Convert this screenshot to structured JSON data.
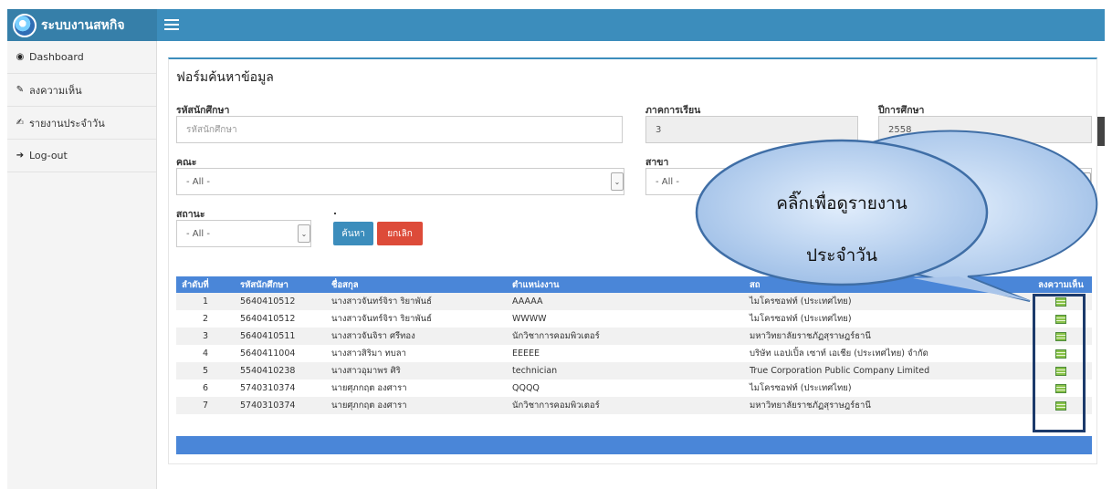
{
  "app": {
    "title": "ระบบงานสหกิจ"
  },
  "sidebar": {
    "items": [
      {
        "icon": "dashboard-icon",
        "label": "Dashboard"
      },
      {
        "icon": "pencil-icon",
        "label": "ลงความเห็น"
      },
      {
        "icon": "edit-icon",
        "label": "รายงานประจำวัน"
      },
      {
        "icon": "logout-icon",
        "label": "Log-out"
      }
    ]
  },
  "form": {
    "title": "ฟอร์มค้นหาข้อมูล",
    "student_id": {
      "label": "รหัสนักศึกษา",
      "placeholder": "รหัสนักศึกษา"
    },
    "semester": {
      "label": "ภาคการเรียน",
      "value": "3"
    },
    "year": {
      "label": "ปีการศึกษา",
      "value": "2558"
    },
    "faculty": {
      "label": "คณะ",
      "value": "- All -"
    },
    "branch": {
      "label": "สาขา",
      "value": "- All -"
    },
    "status": {
      "label": "สถานะ",
      "value": "- All -"
    },
    "dot_label": ".",
    "search_button": "ค้นหา",
    "cancel_button": "ยกเลิก"
  },
  "table": {
    "headers": [
      "ลำดับที่",
      "รหัสนักศึกษา",
      "ชื่อสกุล",
      "ตำแหน่งงาน",
      "สถ",
      "ลงความเห็น"
    ],
    "rows": [
      [
        "1",
        "5640410512",
        "นางสาวจันทร์จิรา ริยาพันธ์",
        "AAAAA",
        "ไมโครซอฟท์ (ประเทศไทย)"
      ],
      [
        "2",
        "5640410512",
        "นางสาวจันทร์จิรา ริยาพันธ์",
        "WWWW",
        "ไมโครซอฟท์ (ประเทศไทย)"
      ],
      [
        "3",
        "5640410511",
        "นางสาวจันจิรา ศรีทอง",
        "นักวิชาการคอมพิวเตอร์",
        "มหาวิทยาลัยราชภัฏสุราษฎร์ธานี"
      ],
      [
        "4",
        "5640411004",
        "นางสาวสิริมา ทบลา",
        "EEEEE",
        "บริษัท แอปเปิ้ล เซาท์ เอเชีย (ประเทศไทย) จำกัด"
      ],
      [
        "5",
        "5540410238",
        "นางสาวอุมาพร ศิริ",
        "technician",
        "True Corporation Public Company Limited"
      ],
      [
        "6",
        "5740310374",
        "นายศุภกฤต องศารา",
        "QQQQ",
        "ไมโครซอฟท์ (ประเทศไทย)"
      ],
      [
        "7",
        "5740310374",
        "นายศุภกฤต องศารา",
        "นักวิชาการคอมพิวเตอร์",
        "มหาวิทยาลัยราชภัฏสุราษฎร์ธานี"
      ]
    ]
  },
  "callout": {
    "line1": "คลิ๊กเพื่อดูรายงาน",
    "line2": "ประจำวัน"
  },
  "colors": {
    "header": "#3c8dbc",
    "table_header": "#4a86d8",
    "danger": "#dd4b39",
    "callout": "#a9c5ea"
  }
}
